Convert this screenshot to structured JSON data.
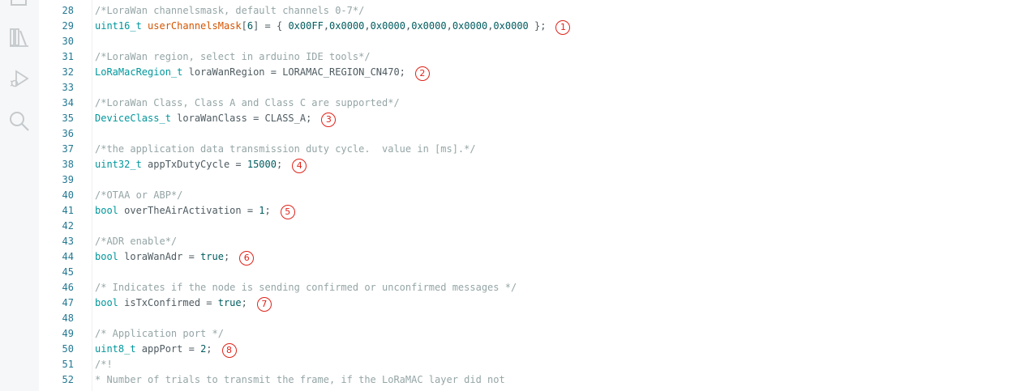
{
  "activity_bar": {
    "icons": [
      "files-icon",
      "library-icon",
      "debug-icon",
      "search-icon"
    ]
  },
  "editor": {
    "lines": [
      {
        "num": "28",
        "tokens": [
          {
            "t": "comment",
            "v": "/*LoraWan channelsmask, default channels 0-7*/"
          }
        ]
      },
      {
        "num": "29",
        "tokens": [
          {
            "t": "type",
            "v": "uint16_t"
          },
          {
            "t": "plain",
            "v": " "
          },
          {
            "t": "ident",
            "v": "userChannelsMask"
          },
          {
            "t": "plain",
            "v": "["
          },
          {
            "t": "number",
            "v": "6"
          },
          {
            "t": "plain",
            "v": "] = { "
          },
          {
            "t": "number",
            "v": "0x00FF"
          },
          {
            "t": "plain",
            "v": ","
          },
          {
            "t": "number",
            "v": "0x0000"
          },
          {
            "t": "plain",
            "v": ","
          },
          {
            "t": "number",
            "v": "0x0000"
          },
          {
            "t": "plain",
            "v": ","
          },
          {
            "t": "number",
            "v": "0x0000"
          },
          {
            "t": "plain",
            "v": ","
          },
          {
            "t": "number",
            "v": "0x0000"
          },
          {
            "t": "plain",
            "v": ","
          },
          {
            "t": "number",
            "v": "0x0000"
          },
          {
            "t": "plain",
            "v": " };"
          }
        ],
        "badge": "1"
      },
      {
        "num": "30",
        "tokens": []
      },
      {
        "num": "31",
        "tokens": [
          {
            "t": "comment",
            "v": "/*LoraWan region, select in arduino IDE tools*/"
          }
        ]
      },
      {
        "num": "32",
        "tokens": [
          {
            "t": "type",
            "v": "LoRaMacRegion_t"
          },
          {
            "t": "plain",
            "v": " loraWanRegion = LORAMAC_REGION_CN470;"
          }
        ],
        "badge": "2"
      },
      {
        "num": "33",
        "tokens": []
      },
      {
        "num": "34",
        "tokens": [
          {
            "t": "comment",
            "v": "/*LoraWan Class, Class A and Class C are supported*/"
          }
        ]
      },
      {
        "num": "35",
        "tokens": [
          {
            "t": "type",
            "v": "DeviceClass_t"
          },
          {
            "t": "plain",
            "v": " loraWanClass = CLASS_A;"
          }
        ],
        "badge": "3"
      },
      {
        "num": "36",
        "tokens": []
      },
      {
        "num": "37",
        "tokens": [
          {
            "t": "comment",
            "v": "/*the application data transmission duty cycle.  value in [ms].*/"
          }
        ]
      },
      {
        "num": "38",
        "tokens": [
          {
            "t": "type",
            "v": "uint32_t"
          },
          {
            "t": "plain",
            "v": " appTxDutyCycle = "
          },
          {
            "t": "number",
            "v": "15000"
          },
          {
            "t": "plain",
            "v": ";"
          }
        ],
        "badge": "4"
      },
      {
        "num": "39",
        "tokens": []
      },
      {
        "num": "40",
        "tokens": [
          {
            "t": "comment",
            "v": "/*OTAA or ABP*/"
          }
        ]
      },
      {
        "num": "41",
        "tokens": [
          {
            "t": "type",
            "v": "bool"
          },
          {
            "t": "plain",
            "v": " overTheAirActivation = "
          },
          {
            "t": "number",
            "v": "1"
          },
          {
            "t": "plain",
            "v": ";"
          }
        ],
        "badge": "5"
      },
      {
        "num": "42",
        "tokens": []
      },
      {
        "num": "43",
        "tokens": [
          {
            "t": "comment",
            "v": "/*ADR enable*/"
          }
        ]
      },
      {
        "num": "44",
        "tokens": [
          {
            "t": "type",
            "v": "bool"
          },
          {
            "t": "plain",
            "v": " loraWanAdr = "
          },
          {
            "t": "number",
            "v": "true"
          },
          {
            "t": "plain",
            "v": ";"
          }
        ],
        "badge": "6"
      },
      {
        "num": "45",
        "tokens": []
      },
      {
        "num": "46",
        "tokens": [
          {
            "t": "comment",
            "v": "/* Indicates if the node is sending confirmed or unconfirmed messages */"
          }
        ]
      },
      {
        "num": "47",
        "tokens": [
          {
            "t": "type",
            "v": "bool"
          },
          {
            "t": "plain",
            "v": " isTxConfirmed = "
          },
          {
            "t": "number",
            "v": "true"
          },
          {
            "t": "plain",
            "v": ";"
          }
        ],
        "badge": "7"
      },
      {
        "num": "48",
        "tokens": []
      },
      {
        "num": "49",
        "tokens": [
          {
            "t": "comment",
            "v": "/* Application port */"
          }
        ]
      },
      {
        "num": "50",
        "tokens": [
          {
            "t": "type",
            "v": "uint8_t"
          },
          {
            "t": "plain",
            "v": " appPort = "
          },
          {
            "t": "number",
            "v": "2"
          },
          {
            "t": "plain",
            "v": ";"
          }
        ],
        "badge": "8"
      },
      {
        "num": "51",
        "tokens": [
          {
            "t": "comment",
            "v": "/*!"
          }
        ]
      },
      {
        "num": "52",
        "tokens": [
          {
            "t": "comment",
            "v": "* Number of trials to transmit the frame, if the LoRaMAC layer did not"
          }
        ]
      }
    ]
  }
}
